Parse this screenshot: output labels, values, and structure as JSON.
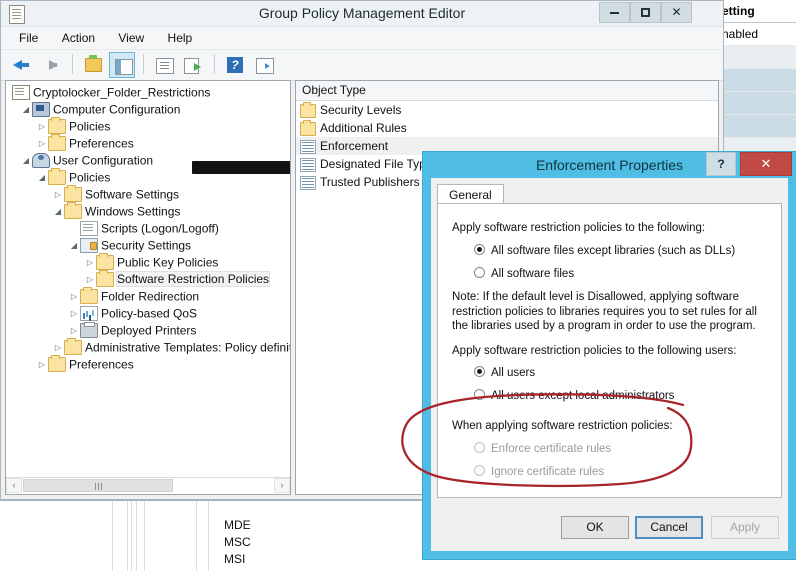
{
  "window": {
    "title": "Group Policy Management Editor",
    "icon": "console-icon",
    "buttons": {
      "minimize": "–",
      "maximize": "□",
      "close": "✕"
    },
    "menus": [
      "File",
      "Action",
      "View",
      "Help"
    ],
    "toolbar": [
      {
        "name": "back-button",
        "icon": "back-arrow-icon"
      },
      {
        "name": "forward-button",
        "icon": "forward-arrow-icon"
      },
      {
        "name": "up-one-level-button",
        "icon": "folder-up-icon"
      },
      {
        "name": "show-hide-tree-button",
        "icon": "console-tree-icon",
        "selected": true
      },
      {
        "name": "properties-button",
        "icon": "properties-icon"
      },
      {
        "name": "export-list-button",
        "icon": "export-icon"
      },
      {
        "name": "help-button",
        "icon": "help-icon"
      },
      {
        "name": "show-view-button",
        "icon": "view-icon"
      }
    ]
  },
  "tree": {
    "root": {
      "label": "Cryptolocker_Folder_Restrictions",
      "icon": "console-icon",
      "redacted": true
    },
    "nodes": [
      {
        "label": "Computer Configuration",
        "indent": 1,
        "expander": "◢",
        "icon": "computer"
      },
      {
        "label": "Policies",
        "indent": 2,
        "expander": "▷",
        "icon": "folder"
      },
      {
        "label": "Preferences",
        "indent": 2,
        "expander": "▷",
        "icon": "folder"
      },
      {
        "label": "User Configuration",
        "indent": 1,
        "expander": "◢",
        "icon": "user"
      },
      {
        "label": "Policies",
        "indent": 2,
        "expander": "◢",
        "icon": "folder"
      },
      {
        "label": "Software Settings",
        "indent": 3,
        "expander": "▷",
        "icon": "folder"
      },
      {
        "label": "Windows Settings",
        "indent": 3,
        "expander": "◢",
        "icon": "folder"
      },
      {
        "label": "Scripts (Logon/Logoff)",
        "indent": 4,
        "expander": "",
        "icon": "script"
      },
      {
        "label": "Security Settings",
        "indent": 4,
        "expander": "◢",
        "icon": "security"
      },
      {
        "label": "Public Key Policies",
        "indent": 5,
        "expander": "▷",
        "icon": "folder"
      },
      {
        "label": "Software Restriction Policies",
        "indent": 5,
        "expander": "▷",
        "icon": "folder",
        "selected": true
      },
      {
        "label": "Folder Redirection",
        "indent": 3,
        "expander": "▷",
        "icon": "folder"
      },
      {
        "label": "Policy-based QoS",
        "indent": 3,
        "expander": "▷",
        "icon": "qos"
      },
      {
        "label": "Deployed Printers",
        "indent": 3,
        "expander": "▷",
        "icon": "printer"
      },
      {
        "label": "Administrative Templates: Policy definitio",
        "indent": 2,
        "expander": "▷",
        "icon": "folder"
      },
      {
        "label": "Preferences",
        "indent": 1,
        "expander": "▷",
        "icon": "folder"
      }
    ],
    "scrollbar": {
      "left_arrow": "‹",
      "right_arrow": "›",
      "thumb": "‖"
    }
  },
  "list": {
    "header": "Object Type",
    "items": [
      {
        "label": "Security Levels",
        "icon": "folder"
      },
      {
        "label": "Additional Rules",
        "icon": "folder"
      },
      {
        "label": "Enforcement",
        "icon": "reg",
        "selected": true
      },
      {
        "label": "Designated File Types",
        "icon": "reg"
      },
      {
        "label": "Trusted Publishers",
        "icon": "reg"
      }
    ]
  },
  "dialog": {
    "title": "Enforcement Properties",
    "help_button": "?",
    "close_button": "✕",
    "tabs": [
      "General"
    ],
    "section1": {
      "label": "Apply software restriction policies to the following:",
      "options": [
        {
          "label": "All software files except libraries (such as DLLs)",
          "checked": true,
          "disabled": false
        },
        {
          "label": "All software files",
          "checked": false,
          "disabled": false
        }
      ],
      "note": "Note:  If the default level is Disallowed, applying software restriction policies to libraries requires you to set rules for all the libraries used by a program in order to use the program."
    },
    "section2": {
      "label": "Apply software restriction policies to the following users:",
      "options": [
        {
          "label": "All users",
          "checked": true,
          "disabled": false
        },
        {
          "label": "All users except local administrators",
          "checked": false,
          "disabled": false
        }
      ]
    },
    "section3": {
      "label": "When applying software restriction policies:",
      "options": [
        {
          "label": "Enforce certificate rules",
          "checked": false,
          "disabled": true
        },
        {
          "label": "Ignore certificate rules",
          "checked": false,
          "disabled": true
        }
      ]
    },
    "buttons": [
      {
        "label": "OK",
        "state": "normal"
      },
      {
        "label": "Cancel",
        "state": "focused"
      },
      {
        "label": "Apply",
        "state": "disabled"
      }
    ]
  },
  "background": {
    "right_panel": {
      "header": "Setting",
      "value": "Enabled",
      "second_header": "Setting"
    },
    "bottom_panel": {
      "extensions": [
        "MDE",
        "MSC",
        "MSI"
      ]
    }
  },
  "annotation": {
    "type": "hand-drawn-red-ellipse",
    "color": "#a8252b",
    "target": "When applying software restriction policies section"
  }
}
